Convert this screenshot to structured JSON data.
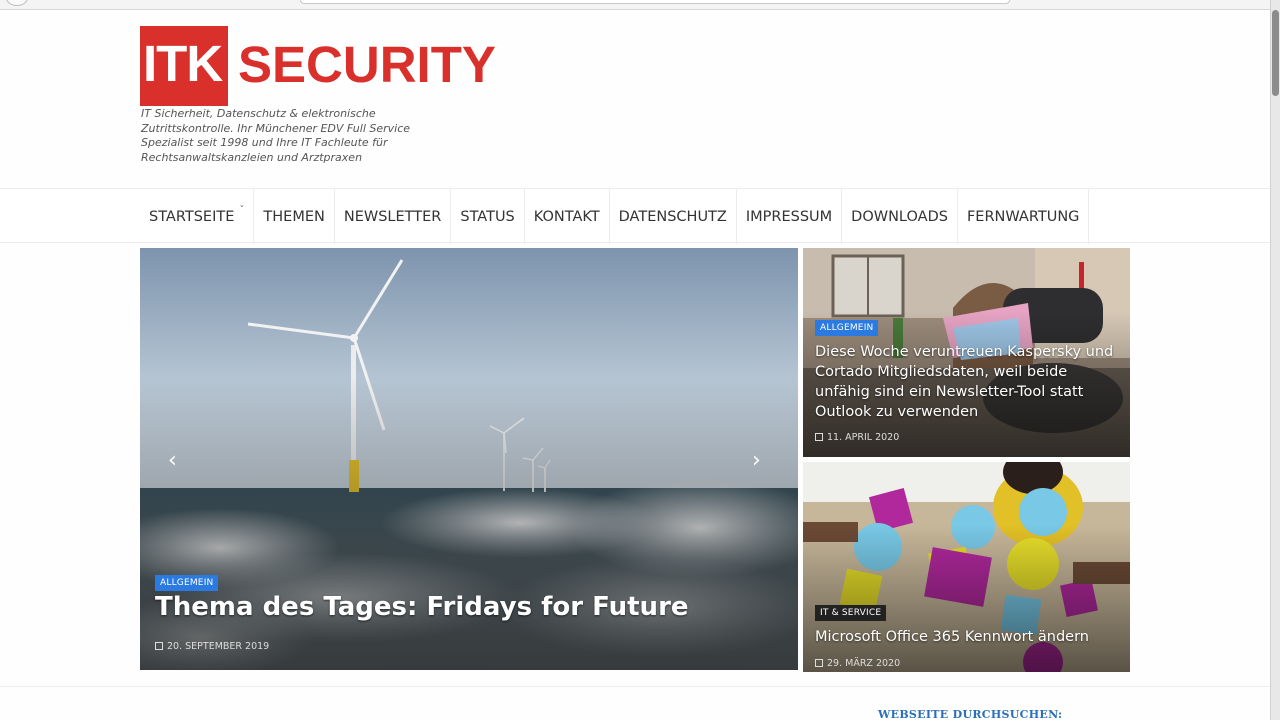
{
  "header": {
    "logo_mark": "ITK",
    "logo_word": "SECURITY",
    "tagline": "IT Sicherheit, Datenschutz & elektronische Zutrittskontrolle. Ihr Münchener EDV Full Service Spezialist seit 1998 und Ihre IT Fachleute für Rechtsanwaltskanzleien und Arztpraxen",
    "brand_color": "#d9302c"
  },
  "nav": {
    "items": [
      {
        "label": "STARTSEITE"
      },
      {
        "label": "THEMEN"
      },
      {
        "label": "NEWSLETTER"
      },
      {
        "label": "STATUS"
      },
      {
        "label": "KONTAKT"
      },
      {
        "label": "DATENSCHUTZ"
      },
      {
        "label": "IMPRESSUM"
      },
      {
        "label": "DOWNLOADS"
      },
      {
        "label": "FERNWARTUNG"
      }
    ],
    "dropdown_indicator": "ˇ"
  },
  "slider": {
    "main": {
      "category": "ALLGEMEIN",
      "title": "Thema des Tages: Fridays for Future",
      "date": "20. SEPTEMBER 2019"
    },
    "prev_arrow": "‹",
    "next_arrow": "›"
  },
  "side_posts": [
    {
      "category": "ALLGEMEIN",
      "title": "Diese Woche veruntreuen Kaspersky und Cortado Mitgliedsdaten, weil beide unfähig sind ein Newsletter-Tool statt Outlook zu verwenden",
      "date": "11. APRIL 2020"
    },
    {
      "category": "IT & SERVICE",
      "title": "Microsoft Office 365 Kennwort ändern",
      "date": "29. MÄRZ 2020"
    }
  ],
  "sidebar": {
    "search_widget_title": "WEBSEITE DURCHSUCHEN:"
  },
  "colors": {
    "badge_blue": "#2a7ae2",
    "widget_title": "#2a6fb8"
  }
}
